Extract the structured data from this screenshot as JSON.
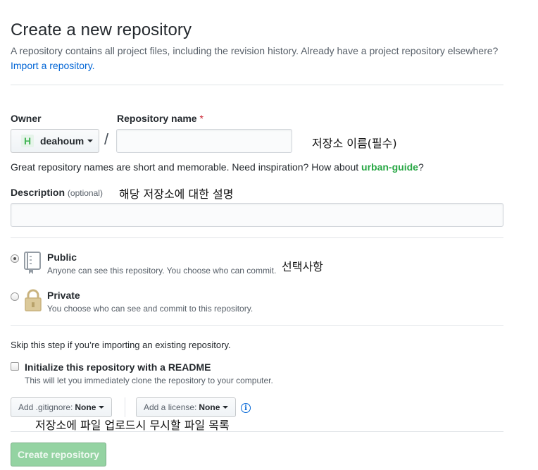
{
  "header": {
    "title": "Create a new repository",
    "subtitle": "A repository contains all project files, including the revision history. Already have a project repository elsewhere?",
    "import_link": "Import a repository."
  },
  "owner": {
    "label": "Owner",
    "avatar_letter": "H",
    "name": "deahoum",
    "icon": "chevron-down-icon"
  },
  "slash": "/",
  "repo_name": {
    "label": "Repository name",
    "required_mark": "*",
    "value": "",
    "placeholder": ""
  },
  "annotations": {
    "repo_name": "저장소 이름(필수)",
    "description": "해당 저장소에 대한 설명",
    "visibility": "선택사항",
    "gitignore": "저장소에 파일 업로드시 무시할 파일 목록"
  },
  "hint": {
    "prefix": "Great repository names are short and memorable. Need inspiration? How about ",
    "suggestion": "urban-guide",
    "suffix": "?"
  },
  "description": {
    "label": "Description",
    "optional": "(optional)",
    "value": ""
  },
  "visibility": {
    "public": {
      "title": "Public",
      "desc": "Anyone can see this repository. You choose who can commit.",
      "selected": true,
      "icon": "repo-book-icon"
    },
    "private": {
      "title": "Private",
      "desc": "You choose who can see and commit to this repository.",
      "selected": false,
      "icon": "lock-icon"
    }
  },
  "import_skip_note": "Skip this step if you’re importing an existing repository.",
  "readme": {
    "label": "Initialize this repository with a README",
    "desc": "This will let you immediately clone the repository to your computer.",
    "checked": false
  },
  "gitignore": {
    "label": "Add .gitignore:",
    "value": "None"
  },
  "license": {
    "label": "Add a license:",
    "value": "None",
    "info_icon": "info-icon"
  },
  "submit": {
    "label": "Create repository",
    "enabled": false
  },
  "colors": {
    "link": "#0366d6",
    "suggestion": "#28a745",
    "required": "#cb2431",
    "create_button_disabled": "#94d3a2"
  }
}
